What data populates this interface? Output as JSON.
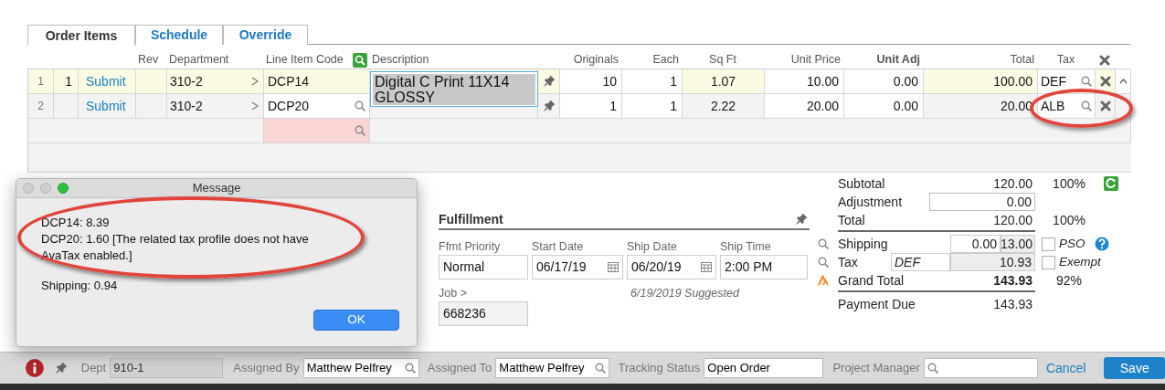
{
  "tabs": [
    {
      "label": "Order Items",
      "selected": true
    },
    {
      "label": "Schedule",
      "selected": false
    },
    {
      "label": "Override",
      "selected": false
    }
  ],
  "table": {
    "columns": [
      {
        "label": "Rev",
        "emphasized": false
      },
      {
        "label": "Department",
        "emphasized": false
      },
      {
        "label": "Line Item Code",
        "emphasized": false
      },
      {
        "label": "Description",
        "emphasized": false
      },
      {
        "label": "Originals",
        "emphasized": false
      },
      {
        "label": "Each",
        "emphasized": false
      },
      {
        "label": "Sq Ft",
        "emphasized": false
      },
      {
        "label": "Unit Price",
        "emphasized": false
      },
      {
        "label": "Unit Adj",
        "emphasized": true
      },
      {
        "label": "Total",
        "emphasized": false
      },
      {
        "label": "Tax",
        "emphasized": false
      }
    ],
    "rows": [
      {
        "row_number": "1",
        "sequence": "1",
        "action": "Submit",
        "department": "310-2",
        "line_item_code": "DCP14",
        "description": "Digital C Print 11X14 GLOSSY",
        "editing": true,
        "originals": "10",
        "each": "1",
        "sq_ft": "1.07",
        "unit_price": "10.00",
        "unit_adj": "0.00",
        "total": "100.00",
        "tax": "DEF",
        "selected": true
      },
      {
        "row_number": "2",
        "action": "Submit",
        "department": "310-2",
        "line_item_code": "DCP20",
        "originals": "1",
        "each": "1",
        "sq_ft": "2.22",
        "unit_price": "20.00",
        "unit_adj": "0.00",
        "total": "20.00",
        "tax": "ALB",
        "selected": false
      }
    ]
  },
  "message_dialog": {
    "title": "Message",
    "lines": [
      "DCP14: 8.39",
      "DCP20: 1.60 [The related tax profile does not have AvaTax enabled.]"
    ],
    "note": "Shipping: 0.94",
    "button": "OK"
  },
  "fulfillment": {
    "title": "Fulfillment",
    "fields": [
      {
        "label": "Ffmt Priority",
        "value": "Normal",
        "kind": "text"
      },
      {
        "label": "Start Date",
        "value": "06/17/19",
        "kind": "date"
      },
      {
        "label": "Ship Date",
        "value": "06/20/19",
        "kind": "date"
      },
      {
        "label": "Ship Time",
        "value": "2:00 PM",
        "kind": "text"
      }
    ],
    "job": {
      "label": "Job >",
      "value": "668236"
    },
    "suggestion": "6/19/2019 Suggested"
  },
  "totals": {
    "subtotal": {
      "label": "Subtotal",
      "value": "120.00",
      "percent": "100%"
    },
    "adjustment": {
      "label": "Adjustment",
      "value": "0.00"
    },
    "total": {
      "label": "Total",
      "value": "120.00",
      "percent": "100%"
    },
    "shipping": {
      "label": "Shipping",
      "value": "0.00",
      "charge": "13.00"
    },
    "tax": {
      "label": "Tax",
      "profile": "DEF",
      "value": "10.93"
    },
    "grand_total": {
      "label": "Grand Total",
      "value": "143.93",
      "percent": "92%"
    },
    "payment_due": {
      "label": "Payment Due",
      "value": "143.93"
    },
    "options": [
      {
        "label": "PSO",
        "checked": false
      },
      {
        "label": "Exempt",
        "checked": false
      }
    ]
  },
  "footer": {
    "fields": [
      {
        "label": "Dept",
        "value": "910-1",
        "kind": "readonly"
      },
      {
        "label": "Assigned By",
        "value": "Matthew Pelfrey",
        "kind": "lookup"
      },
      {
        "label": "Assigned To",
        "value": "Matthew Pelfrey",
        "kind": "lookup"
      },
      {
        "label": "Tracking Status",
        "value": "Open Order",
        "kind": "text"
      },
      {
        "label": "Project Manager",
        "kind": "lookup"
      }
    ],
    "buttons": [
      {
        "label": "Cancel",
        "kind": "link"
      },
      {
        "label": "Save",
        "kind": "primary"
      }
    ]
  }
}
